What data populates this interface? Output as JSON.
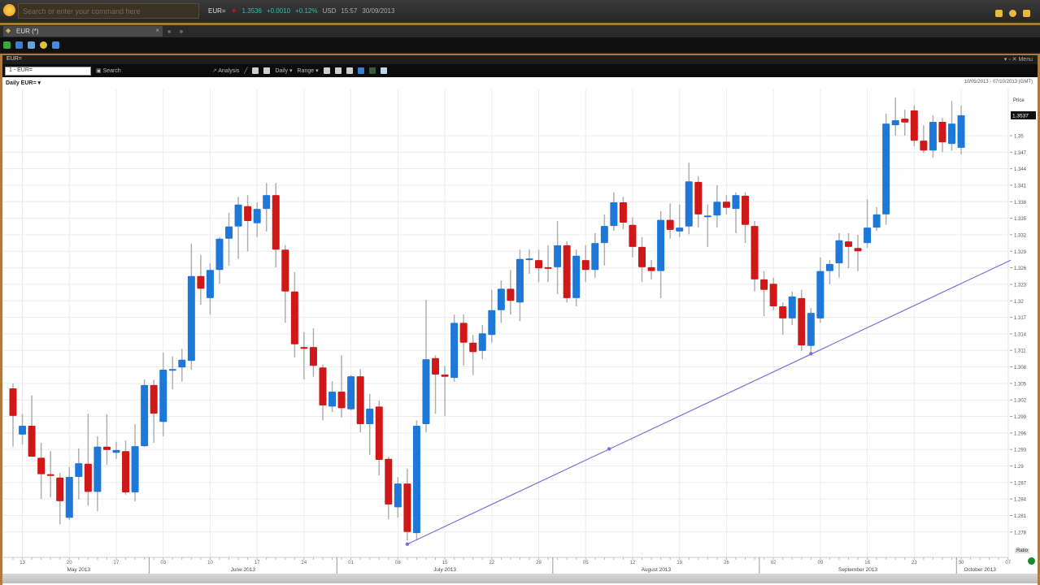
{
  "app": {
    "search_placeholder": "Search or enter your command here",
    "ticker": {
      "symbol": "EUR=",
      "last": "1.3536",
      "change": "+0.0010",
      "pct_change": "+0.12%",
      "currency": "USD",
      "time": "15:57",
      "date": "30/09/2013"
    },
    "tab_label": "EUR (*)",
    "tab_close": "×",
    "tab_buttons": "« »"
  },
  "panel": {
    "title": "EUR=",
    "controls": "▾ ▫ ✕ Menu",
    "symbol_input": "1 - EUR=",
    "toolbar": {
      "search": "Search",
      "analysis": "Analysis",
      "interval": "Daily ▾",
      "range": "Range ▾"
    },
    "chart_title": "Daily EUR= ▾",
    "range_text": "10/05/2013 - 07/10/2013 (GMT)",
    "price_label": "Price",
    "ratio_button": "Ratio"
  },
  "colors": {
    "up": "#1e78d8",
    "down": "#d01818",
    "wick": "#b0b0b0",
    "trendline": "#7b6fe0",
    "grid": "#ececec"
  },
  "chart_data": {
    "type": "candlestick",
    "title": "Daily EUR=",
    "instrument": "EUR=",
    "ylabel": "Price",
    "ylim": [
      1.2755,
      1.358
    ],
    "yticks": [
      "1.278",
      "1.281",
      "1.284",
      "1.287",
      "1.29",
      "1.293",
      "1.296",
      "1.299",
      "1.302",
      "1.305",
      "1.308",
      "1.311",
      "1.314",
      "1.317",
      "1.32",
      "1.323",
      "1.326",
      "1.329",
      "1.332",
      "1.335",
      "1.338",
      "1.341",
      "1.344",
      "1.347",
      "1.35"
    ],
    "last_price_label": "1.3537",
    "xticks": [
      "13",
      "20",
      "27",
      "03",
      "10",
      "17",
      "24",
      "01",
      "08",
      "15",
      "22",
      "29",
      "05",
      "12",
      "19",
      "26",
      "02",
      "09",
      "16",
      "23",
      "30",
      "07"
    ],
    "months": [
      {
        "label": "May 2013",
        "from_index": 0,
        "to_index": 15
      },
      {
        "label": "June 2013",
        "from_index": 15,
        "to_index": 35
      },
      {
        "label": "July 2013",
        "from_index": 35,
        "to_index": 58
      },
      {
        "label": "August 2013",
        "from_index": 58,
        "to_index": 80
      },
      {
        "label": "September 2013",
        "from_index": 80,
        "to_index": 101
      },
      {
        "label": "October 2013",
        "from_index": 101,
        "to_index": 106
      }
    ],
    "first_xtick_index": 1,
    "xtick_step": 5,
    "ohlc": [
      [
        1.3041,
        1.305,
        1.2935,
        1.2991
      ],
      [
        1.2957,
        1.2995,
        1.2939,
        1.2973
      ],
      [
        1.2973,
        1.3028,
        1.2917,
        1.2917
      ],
      [
        1.2915,
        1.2942,
        1.284,
        1.2885
      ],
      [
        1.2885,
        1.2927,
        1.2843,
        1.2882
      ],
      [
        1.2879,
        1.2887,
        1.2794,
        1.2836
      ],
      [
        1.2806,
        1.2898,
        1.2802,
        1.288
      ],
      [
        1.288,
        1.2932,
        1.2839,
        1.2905
      ],
      [
        1.2904,
        1.2995,
        1.2828,
        1.2853
      ],
      [
        1.2853,
        1.2954,
        1.2818,
        1.2935
      ],
      [
        1.2935,
        1.2994,
        1.2902,
        1.2929
      ],
      [
        1.2924,
        1.2944,
        1.2913,
        1.2929
      ],
      [
        1.2927,
        1.2946,
        1.2848,
        1.2852
      ],
      [
        1.2852,
        1.2976,
        1.2836,
        1.2936
      ],
      [
        1.2936,
        1.3057,
        1.2935,
        1.3047
      ],
      [
        1.3047,
        1.3057,
        1.2942,
        1.2995
      ],
      [
        1.298,
        1.3106,
        1.2954,
        1.3075
      ],
      [
        1.3075,
        1.3099,
        1.3039,
        1.3076
      ],
      [
        1.3079,
        1.3113,
        1.3053,
        1.3093
      ],
      [
        1.3091,
        1.3304,
        1.3075,
        1.3245
      ],
      [
        1.3245,
        1.3283,
        1.3193,
        1.3222
      ],
      [
        1.3205,
        1.3268,
        1.3175,
        1.3256
      ],
      [
        1.3256,
        1.3316,
        1.3231,
        1.3313
      ],
      [
        1.3313,
        1.336,
        1.3264,
        1.3335
      ],
      [
        1.3335,
        1.3389,
        1.3276,
        1.3375
      ],
      [
        1.3372,
        1.3392,
        1.329,
        1.3345
      ],
      [
        1.3341,
        1.3379,
        1.3316,
        1.3367
      ],
      [
        1.3367,
        1.3414,
        1.3326,
        1.3392
      ],
      [
        1.3392,
        1.3414,
        1.3261,
        1.3293
      ],
      [
        1.3293,
        1.3301,
        1.316,
        1.3217
      ],
      [
        1.3217,
        1.3252,
        1.3097,
        1.3121
      ],
      [
        1.3116,
        1.3143,
        1.3057,
        1.3113
      ],
      [
        1.3116,
        1.315,
        1.3062,
        1.3082
      ],
      [
        1.3079,
        1.3084,
        1.2983,
        1.301
      ],
      [
        1.3008,
        1.3054,
        1.2998,
        1.3035
      ],
      [
        1.3035,
        1.3101,
        1.2988,
        1.3005
      ],
      [
        1.3003,
        1.3065,
        1.3001,
        1.3063
      ],
      [
        1.3063,
        1.3076,
        1.2961,
        1.2976
      ],
      [
        1.2976,
        1.3031,
        1.292,
        1.3004
      ],
      [
        1.3008,
        1.3019,
        1.2883,
        1.2911
      ],
      [
        1.2913,
        1.2917,
        1.2803,
        1.283
      ],
      [
        1.2825,
        1.288,
        1.2806,
        1.2868
      ],
      [
        1.2868,
        1.2895,
        1.2765,
        1.278
      ],
      [
        1.2778,
        1.2983,
        1.2765,
        1.2973
      ],
      [
        1.2976,
        1.3202,
        1.2961,
        1.3094
      ],
      [
        1.3096,
        1.3101,
        1.2995,
        1.3066
      ],
      [
        1.3066,
        1.3082,
        1.2991,
        1.3062
      ],
      [
        1.306,
        1.3175,
        1.3053,
        1.316
      ],
      [
        1.316,
        1.3175,
        1.3082,
        1.3124
      ],
      [
        1.3124,
        1.3138,
        1.3065,
        1.3107
      ],
      [
        1.3109,
        1.3156,
        1.3094,
        1.3141
      ],
      [
        1.3138,
        1.322,
        1.3124,
        1.3183
      ],
      [
        1.3183,
        1.3237,
        1.316,
        1.3222
      ],
      [
        1.3222,
        1.3256,
        1.3175,
        1.32
      ],
      [
        1.3197,
        1.3293,
        1.3163,
        1.3276
      ],
      [
        1.3274,
        1.3293,
        1.3249,
        1.3277
      ],
      [
        1.3274,
        1.3293,
        1.3234,
        1.3259
      ],
      [
        1.3261,
        1.3301,
        1.3234,
        1.3259
      ],
      [
        1.3261,
        1.3345,
        1.3212,
        1.3301
      ],
      [
        1.3301,
        1.3308,
        1.3197,
        1.3205
      ],
      [
        1.3205,
        1.3293,
        1.319,
        1.3282
      ],
      [
        1.3274,
        1.3301,
        1.3234,
        1.3256
      ],
      [
        1.3256,
        1.3323,
        1.3242,
        1.3305
      ],
      [
        1.3305,
        1.3357,
        1.3264,
        1.3336
      ],
      [
        1.3336,
        1.3397,
        1.3327,
        1.3379
      ],
      [
        1.3379,
        1.3389,
        1.333,
        1.3342
      ],
      [
        1.3338,
        1.3352,
        1.3279,
        1.3298
      ],
      [
        1.3298,
        1.3316,
        1.3234,
        1.3261
      ],
      [
        1.3261,
        1.3274,
        1.3239,
        1.3254
      ],
      [
        1.3254,
        1.3363,
        1.3205,
        1.3347
      ],
      [
        1.3347,
        1.3377,
        1.3313,
        1.3329
      ],
      [
        1.3326,
        1.3375,
        1.3316,
        1.3333
      ],
      [
        1.3335,
        1.3451,
        1.3321,
        1.3417
      ],
      [
        1.3416,
        1.3426,
        1.3333,
        1.3357
      ],
      [
        1.3354,
        1.3375,
        1.3298,
        1.3355
      ],
      [
        1.3355,
        1.341,
        1.3333,
        1.338
      ],
      [
        1.338,
        1.3392,
        1.3357,
        1.3369
      ],
      [
        1.3367,
        1.3397,
        1.3323,
        1.3392
      ],
      [
        1.3391,
        1.3397,
        1.3305,
        1.3338
      ],
      [
        1.3336,
        1.3345,
        1.3217,
        1.3239
      ],
      [
        1.3239,
        1.3254,
        1.3172,
        1.322
      ],
      [
        1.3231,
        1.3242,
        1.3183,
        1.319
      ],
      [
        1.319,
        1.3197,
        1.3138,
        1.3168
      ],
      [
        1.3168,
        1.3217,
        1.3156,
        1.3208
      ],
      [
        1.3205,
        1.322,
        1.3109,
        1.3119
      ],
      [
        1.3118,
        1.3187,
        1.3106,
        1.3178
      ],
      [
        1.3168,
        1.3279,
        1.316,
        1.3254
      ],
      [
        1.3254,
        1.3274,
        1.323,
        1.3267
      ],
      [
        1.3268,
        1.3323,
        1.3242,
        1.331
      ],
      [
        1.3308,
        1.3323,
        1.3259,
        1.3298
      ],
      [
        1.3296,
        1.332,
        1.3254,
        1.329
      ],
      [
        1.3305,
        1.3385,
        1.3296,
        1.3333
      ],
      [
        1.3333,
        1.337,
        1.3327,
        1.3357
      ],
      [
        1.3357,
        1.354,
        1.3338,
        1.3522
      ],
      [
        1.3519,
        1.3569,
        1.35,
        1.3528
      ],
      [
        1.3531,
        1.3547,
        1.35,
        1.3524
      ],
      [
        1.3546,
        1.3555,
        1.3481,
        1.3491
      ],
      [
        1.3491,
        1.3519,
        1.3468,
        1.3473
      ],
      [
        1.3473,
        1.3537,
        1.346,
        1.3525
      ],
      [
        1.3525,
        1.3532,
        1.347,
        1.3488
      ],
      [
        1.3485,
        1.3563,
        1.3473,
        1.3522
      ],
      [
        1.3478,
        1.3555,
        1.3466,
        1.3537
      ]
    ],
    "trendline": {
      "points": [
        [
          42,
          1.2758
        ],
        [
          63.5,
          1.2931
        ],
        [
          85,
          1.3104
        ]
      ],
      "end": [
        106.3,
        1.3274
      ]
    }
  }
}
